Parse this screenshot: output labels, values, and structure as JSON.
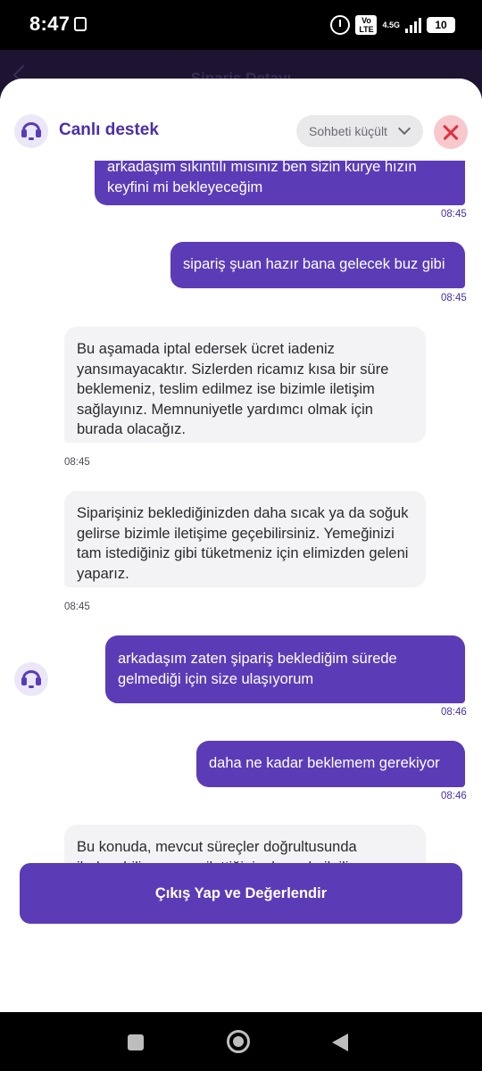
{
  "status_bar": {
    "time": "8:47",
    "network": "4.5G",
    "volte": "Vo LTE",
    "battery": "10"
  },
  "background_page": {
    "title": "Sipariş Detayı"
  },
  "chat_header": {
    "title": "Canlı destek",
    "minimize_label": "Sohbeti küçült"
  },
  "messages": [
    {
      "from": "user",
      "text": "arkadaşım sıkıntılı mısınız ben sizin kurye hızın keyfini mi bekleyeceğim",
      "time": "08:45"
    },
    {
      "from": "user",
      "text": "sipariş şuan hazır bana gelecek buz gibi",
      "time": "08:45"
    },
    {
      "from": "support",
      "text": "Bu aşamada iptal edersek ücret iadeniz yansımayacaktır. Sizlerden ricamız kısa bir süre beklemeniz, teslim edilmez ise bizimle iletişim sağlayınız. Memnuniyetle yardımcı olmak için burada olacağız.",
      "time": "08:45"
    },
    {
      "from": "support",
      "text": "Siparişiniz beklediğinizden daha sıcak ya da soğuk gelirse bizimle iletişime geçebilirsiniz. Yemeğinizi tam istediğiniz gibi tüketmeniz için elimizden geleni yaparız.",
      "time": "08:45"
    },
    {
      "from": "user",
      "text": "arkadaşım zaten şipariş beklediğim sürede gelmediği için size ulaşıyorum",
      "time": "08:46"
    },
    {
      "from": "user",
      "text": "daha ne kadar beklemem gerekiyor",
      "time": "08:46"
    },
    {
      "from": "support",
      "text": "Bu konuda, mevcut süreçler doğrultusunda ilerleyebiliyorum ve ilettiğiniz durumla ilgili şu aşamada paylaşabileceğim ek bir bilgi mevcut değil. Dilerseniz farklı bir konuda size yardımcı",
      "time": ""
    }
  ],
  "action_button": {
    "label": "Çıkış Yap ve Değerlendir"
  },
  "colors": {
    "accent": "#5b3cb6",
    "incoming_bubble": "#f3f3f5",
    "close_bg": "#f7c9cd",
    "close_x": "#e0313e"
  }
}
